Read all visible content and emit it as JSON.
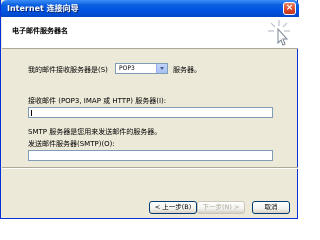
{
  "window": {
    "title": "Internet 连接向导",
    "close_symbol": "×"
  },
  "header": {
    "title": "电子邮件服务器名",
    "icon": "wizard-sparkle-cursor-icon"
  },
  "incoming_type": {
    "label_prefix": "我的邮件接收服务器是(S)",
    "selected": "POP3",
    "label_suffix": "服务器。"
  },
  "incoming_server": {
    "label": "接收邮件 (POP3, IMAP 或 HTTP) 服务器(I):",
    "value": ""
  },
  "smtp": {
    "description": "SMTP 服务器是您用来发送邮件的服务器。",
    "label": "发送邮件服务器(SMTP)(O):",
    "value": ""
  },
  "buttons": {
    "back": "< 上一步(B)",
    "next": "下一步(N) >",
    "cancel": "取消"
  },
  "colors": {
    "titlebar": "#0054e3",
    "dialog_bg": "#ece9d8",
    "header_bg": "#ffffff"
  }
}
